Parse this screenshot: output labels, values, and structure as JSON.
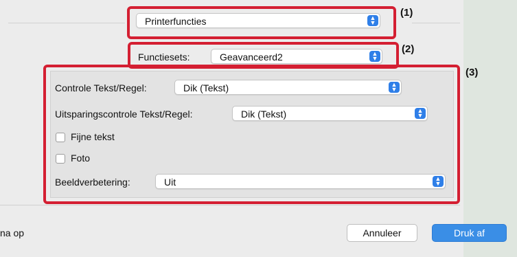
{
  "callouts": [
    "(1)",
    "(2)",
    "(3)"
  ],
  "top_popup": {
    "value": "Printerfuncties"
  },
  "feature_sets": {
    "label": "Functiesets:",
    "value": "Geavanceerd2"
  },
  "panel": {
    "text_line_control": {
      "label": "Controle Tekst/Regel:",
      "value": "Dik (Tekst)"
    },
    "cutout_control": {
      "label": "Uitsparingscontrole Tekst/Regel:",
      "value": "Dik (Tekst)"
    },
    "fine_text": {
      "label": "Fijne tekst",
      "checked": false
    },
    "photo": {
      "label": "Foto",
      "checked": false
    },
    "image_enhance": {
      "label": "Beeldverbetering:",
      "value": "Uit"
    }
  },
  "footer": {
    "left_text": "na op",
    "cancel_label": "Annuleer",
    "print_label": "Druk af"
  },
  "colors": {
    "accent": "#2f7fe8",
    "highlight": "#d41f32",
    "print_button": "#3a8ee6"
  },
  "icons": {
    "stepper": "up-down-arrows-icon"
  }
}
